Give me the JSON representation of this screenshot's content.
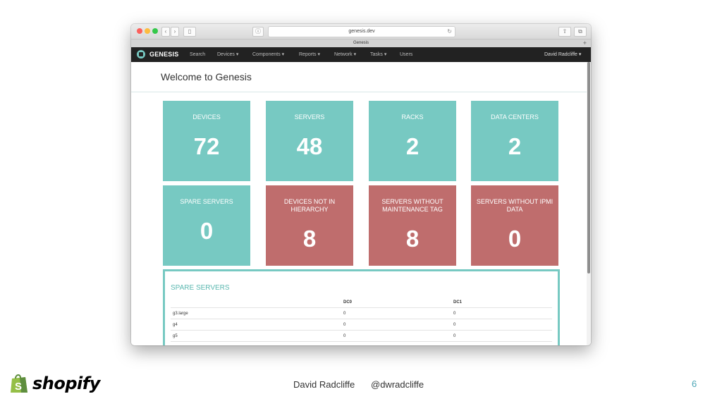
{
  "browser": {
    "url": "genesis.dev",
    "tab_title": "Genesis",
    "new_tab": "+"
  },
  "navbar": {
    "brand": "GENESIS",
    "items": [
      {
        "label": "Search"
      },
      {
        "label": "Devices ▾"
      },
      {
        "label": "Components ▾"
      },
      {
        "label": "Reports ▾"
      },
      {
        "label": "Network ▾"
      },
      {
        "label": "Tasks ▾"
      },
      {
        "label": "Users"
      }
    ],
    "user": "David Radcliffe ▾"
  },
  "page": {
    "title": "Welcome to Genesis"
  },
  "tiles": [
    {
      "label": "DEVICES",
      "value": "72",
      "status": "ok"
    },
    {
      "label": "SERVERS",
      "value": "48",
      "status": "ok"
    },
    {
      "label": "RACKS",
      "value": "2",
      "status": "ok"
    },
    {
      "label": "DATA CENTERS",
      "value": "2",
      "status": "ok"
    },
    {
      "label": "SPARE SERVERS",
      "value": "0",
      "status": "ok"
    },
    {
      "label": "DEVICES NOT IN HIERARCHY",
      "value": "8",
      "status": "alert"
    },
    {
      "label": "SERVERS WITHOUT MAINTENANCE TAG",
      "value": "8",
      "status": "alert"
    },
    {
      "label": "SERVERS WITHOUT IPMI DATA",
      "value": "0",
      "status": "alert"
    }
  ],
  "colors": {
    "ok": "#77c9c2",
    "alert": "#bf6d6d",
    "navbar": "#222222"
  },
  "spare_servers": {
    "title": "SPARE SERVERS",
    "columns": [
      "",
      "DC0",
      "DC1"
    ],
    "rows": [
      [
        "g3.large",
        "0",
        "0"
      ],
      [
        "g4",
        "0",
        "0"
      ],
      [
        "g5",
        "0",
        "0"
      ]
    ]
  },
  "footer": {
    "logo_text": "shopify",
    "presenter": "David Radcliffe",
    "handle": "@dwradcliffe",
    "slide_number": "6"
  },
  "icons": [
    "window-close-icon",
    "window-minimize-icon",
    "window-zoom-icon",
    "back-icon",
    "forward-icon",
    "sidebar-icon",
    "info-icon",
    "reload-icon",
    "share-icon",
    "tabs-icon",
    "genesis-logo-icon",
    "shopify-bag-icon"
  ]
}
